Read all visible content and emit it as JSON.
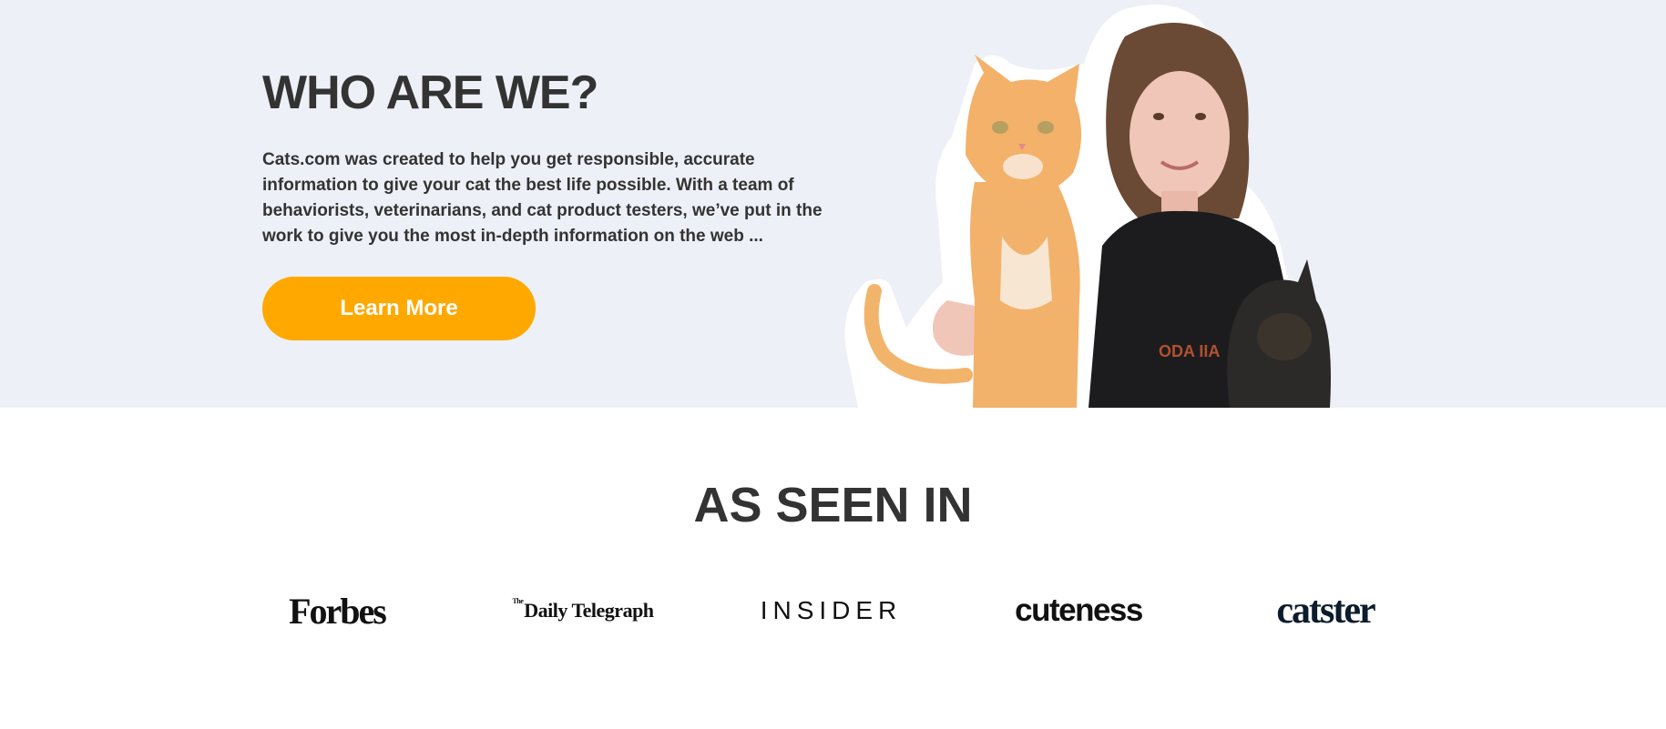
{
  "about": {
    "title": "WHO ARE WE?",
    "text": "Cats.com was created to help you get responsible, accurate information to give your cat the best life possible. With a team of behaviorists, veterinarians, and cat product testers, we’ve put in the work to give you the most in-depth information on the web ...",
    "button_label": "Learn More",
    "shirt_text": "ODA IIA"
  },
  "as_seen_in": {
    "title": "AS SEEN IN",
    "logos": [
      "Forbes",
      "Daily Telegraph",
      "INSIDER",
      "cuteness",
      "catster"
    ],
    "telegraph_prefix": "The"
  },
  "colors": {
    "hero_bg": "#edf0f6",
    "accent": "#ffa800",
    "text": "#333333"
  }
}
